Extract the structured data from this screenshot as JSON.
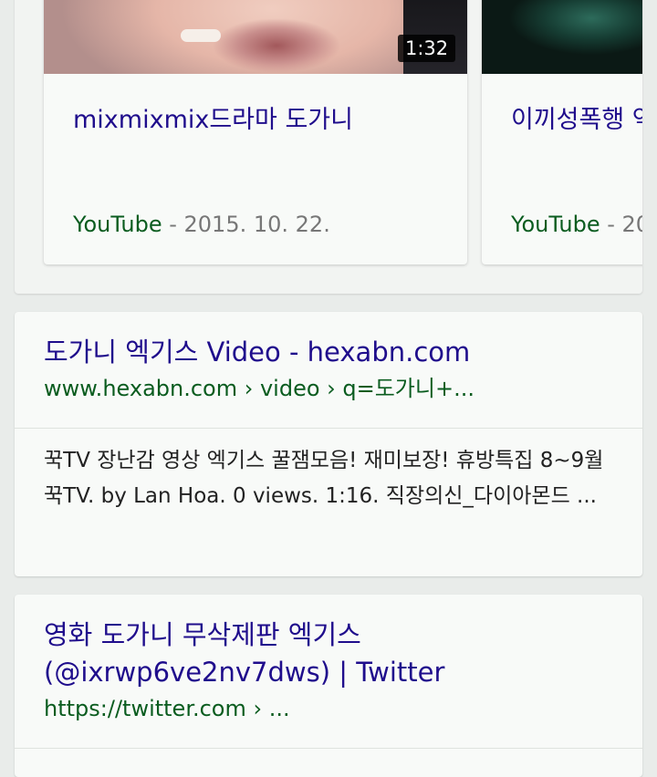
{
  "video_carousel": {
    "videos": [
      {
        "duration": "1:32",
        "title": "mixmixmix드라마 도가니",
        "source": "YouTube",
        "separator": " - ",
        "date": "2015. 10. 22."
      },
      {
        "title": "이끼성폭행 역",
        "source": "YouTube",
        "separator": " - ",
        "date": "20"
      }
    ]
  },
  "results": [
    {
      "title": "도가니 엑기스 Video - hexabn.com",
      "url": "www.hexabn.com › video › q=도가니+...",
      "snippet": "꾹TV 장난감 영상 엑기스 꿀잼모음! 재미보장! 휴방특집 8~9월 꾹TV. by Lan Hoa. 0 views. 1:16. 직장의신_다이아몬드 ..."
    },
    {
      "title_line1": "영화 도가니 무삭제판 엑기스",
      "title_line2": "(@ixrwp6ve2nv7dws) | Twitter",
      "url": "https://twitter.com › ..."
    }
  ],
  "colors": {
    "link_title": "#1f0d8c",
    "url_green": "#0a5c1f",
    "page_bg": "#e9ecea",
    "card_bg": "#f8faf8"
  }
}
